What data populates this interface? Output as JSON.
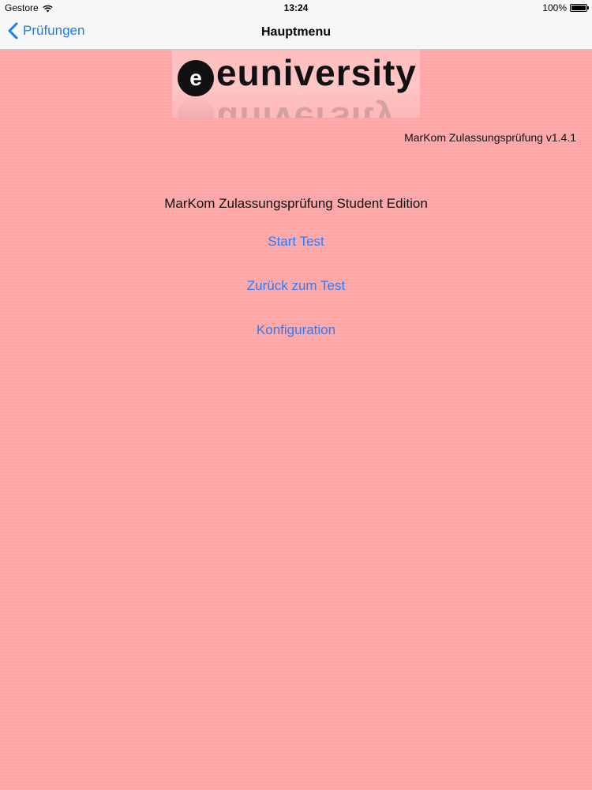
{
  "status_bar": {
    "carrier": "Gestore",
    "time": "13:24",
    "battery": "100%",
    "battery_level": 1.0
  },
  "nav": {
    "back_label": "Prüfungen",
    "title": "Hauptmenu"
  },
  "logo": {
    "text": "euniversity"
  },
  "main": {
    "version": "MarKom Zulassungsprüfung v1.4.1",
    "edition_title": "MarKom Zulassungsprüfung Student Edition",
    "menu": [
      {
        "label": "Start Test"
      },
      {
        "label": "Zurück zum Test"
      },
      {
        "label": "Konfiguration"
      }
    ]
  },
  "colors": {
    "accent": "#2d7cf6",
    "background": "#ffaaaa"
  },
  "icons": {
    "wifi": "wifi-icon",
    "battery": "battery-icon",
    "back": "chevron-left-icon"
  }
}
